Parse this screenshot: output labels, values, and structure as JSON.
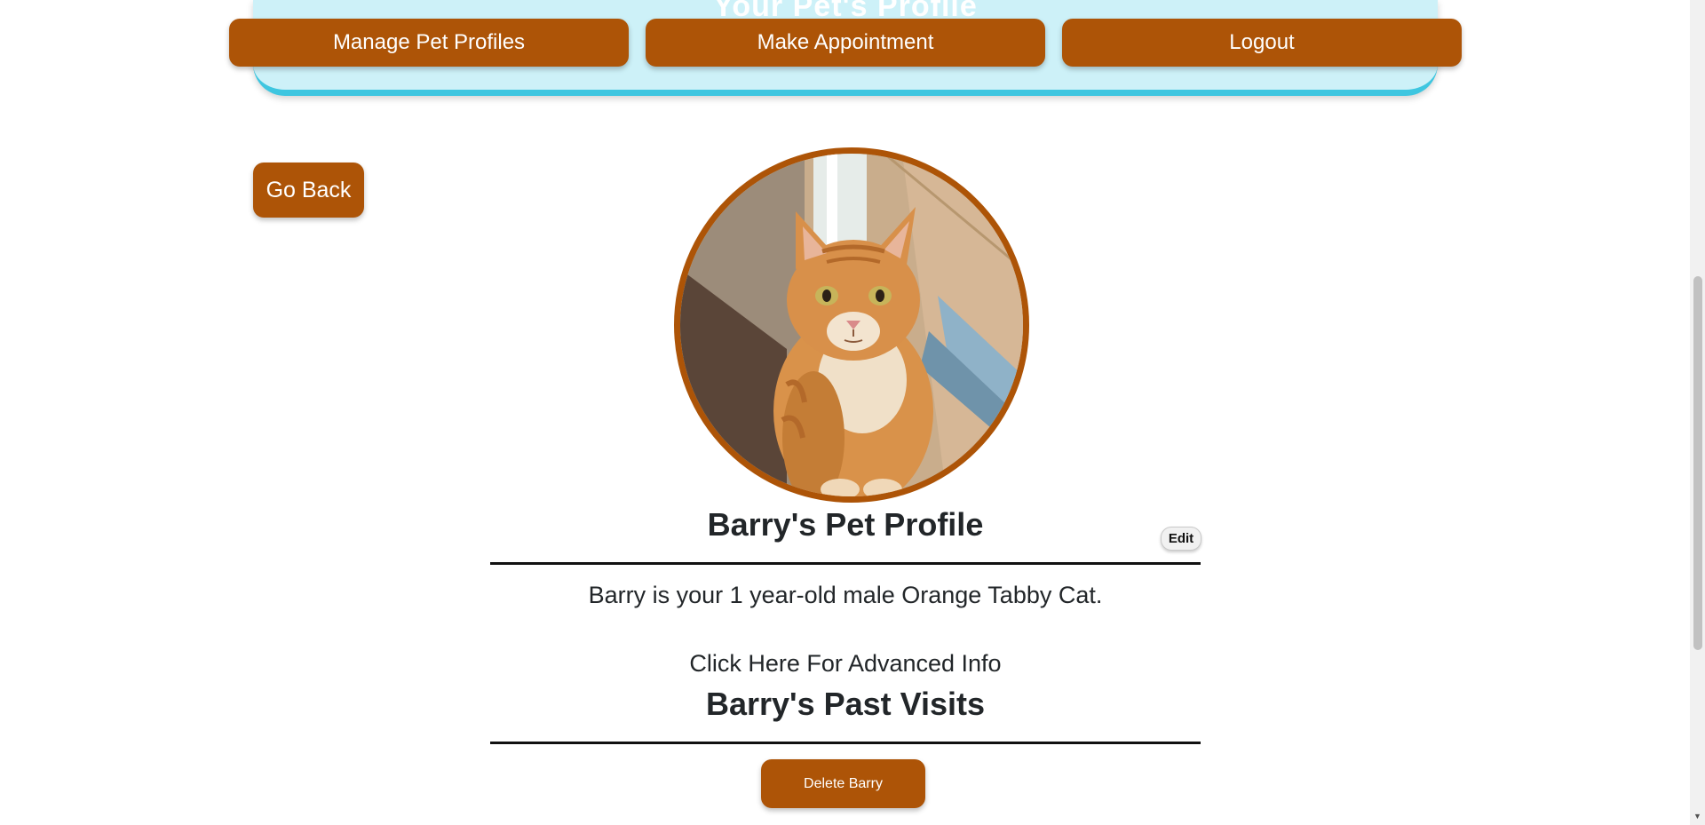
{
  "header": {
    "title": "Your Pet's Profile",
    "nav": {
      "manage_label": "Manage Pet Profiles",
      "appointment_label": "Make Appointment",
      "logout_label": "Logout"
    }
  },
  "page": {
    "go_back_label": "Go Back",
    "profile_title": "Barry's Pet Profile",
    "edit_label": "Edit",
    "description": "Barry is your 1 year-old male Orange Tabby Cat.",
    "advanced_link": "Click Here For Advanced Info",
    "visits_title": "Barry's Past Visits",
    "delete_label": "Delete Barry"
  },
  "colors": {
    "brand_orange": "#ad5407",
    "header_bg": "#cdf1f8",
    "header_accent": "#3ec6e0"
  },
  "icons": {
    "scroll_down": "▼"
  }
}
